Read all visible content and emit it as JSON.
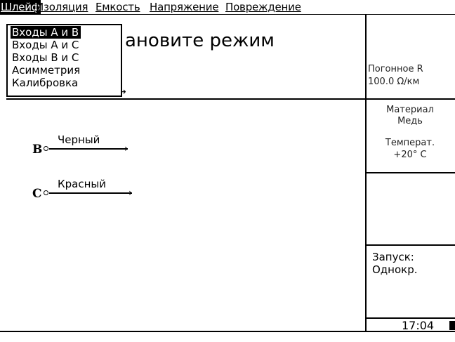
{
  "menu": {
    "items": [
      "Шлейф",
      "Изоляция",
      "Емкость",
      "Напряжение",
      "Повреждение"
    ],
    "active_index": 0
  },
  "dropdown": {
    "items": [
      "Входы А и В",
      "Входы А и С",
      "Входы В и С",
      "Асимметрия",
      "Калибровка"
    ],
    "selected_index": 0
  },
  "main": {
    "title": "ановите режим",
    "terminals": [
      {
        "letter": "B",
        "wire": "Черный"
      },
      {
        "letter": "C",
        "wire": "Красный"
      }
    ]
  },
  "right_panel": {
    "line_resistance_label": "Погонное R",
    "line_resistance_value": "100.0 Ω/км",
    "material_label": "Материал",
    "material_value": "Медь",
    "temp_label": "Температ.",
    "temp_value": "+20° С",
    "start_label": "Запуск:",
    "start_value": "Однокр."
  },
  "status": {
    "time": "17:04"
  }
}
